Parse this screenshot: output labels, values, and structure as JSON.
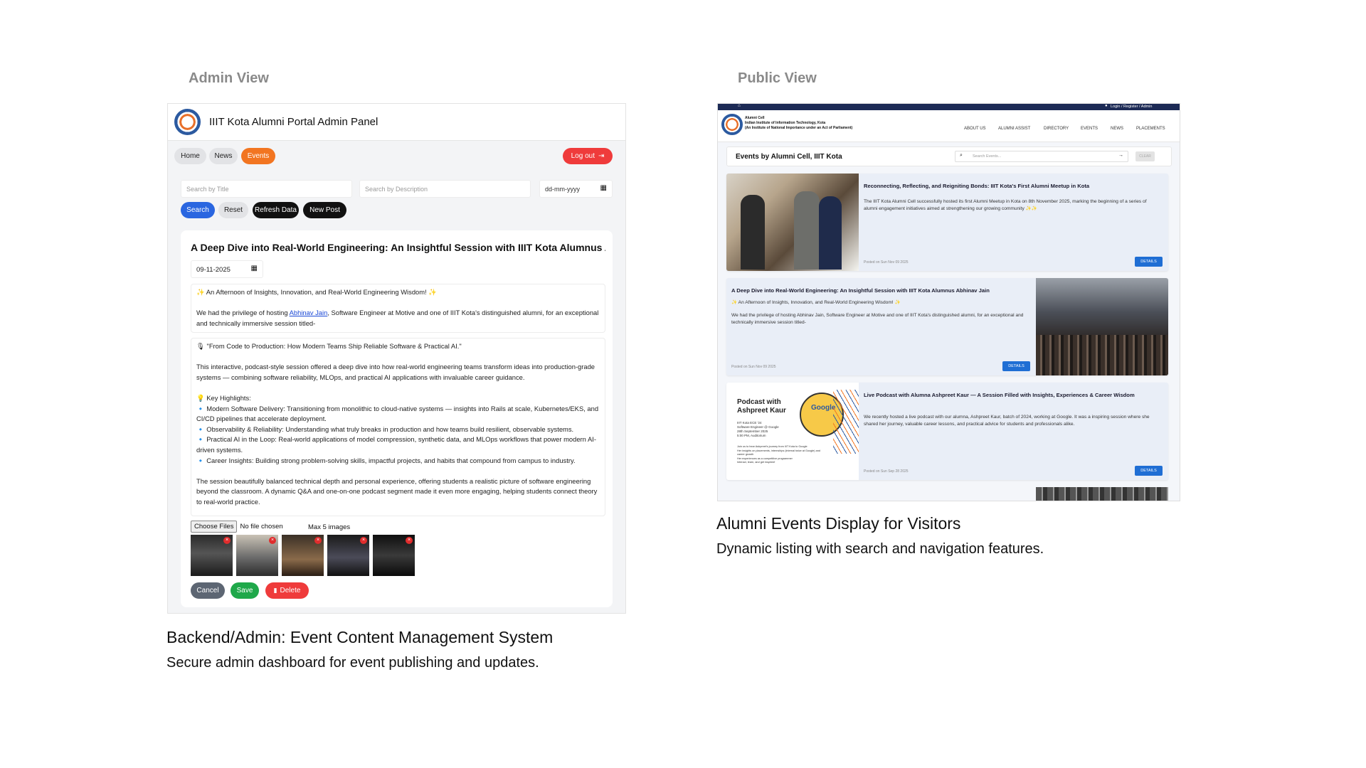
{
  "sections": {
    "admin_heading": "Admin View",
    "public_heading": "Public View"
  },
  "admin": {
    "title": "IIIT Kota Alumni Portal Admin Panel",
    "nav": {
      "home": "Home",
      "news": "News",
      "events": "Events"
    },
    "logout_label": "Log out",
    "filters": {
      "title_placeholder": "Search by Title",
      "description_placeholder": "Search by Description",
      "date_placeholder": "dd-mm-yyyy"
    },
    "actions": {
      "search": "Search",
      "reset": "Reset",
      "refresh": "Refresh Data",
      "new_post": "New Post"
    },
    "post": {
      "title": "A Deep Dive into Real-World Engineering: An Insightful Session with IIIT Kota Alumnus Abhinav Jain",
      "date": "09-11-2025",
      "intro_headline": "✨ An Afternoon of Insights, Innovation, and Real-World Engineering Wisdom! ✨",
      "intro_pre": "We had the privilege of hosting ",
      "intro_link": "Abhinav Jain",
      "intro_post": ", Software Engineer at Motive and one of IIIT Kota's distinguished alumni, for an exceptional and technically immersive session titled-",
      "session_title": "🎙 \"From Code to Production: How Modern Teams Ship Reliable Software & Practical AI.\"",
      "session_desc": "This interactive, podcast-style session offered a deep dive into how real-world engineering teams transform ideas into production-grade systems — combining software reliability, MLOps, and practical AI applications with invaluable career guidance.",
      "highlights_heading": "💡 Key Highlights:",
      "highlights": [
        "🔹 Modern Software Delivery: Transitioning from monolithic to cloud-native systems — insights into Rails at scale, Kubernetes/EKS, and CI/CD pipelines that accelerate deployment.",
        "🔹 Observability & Reliability: Understanding what truly breaks in production and how teams build resilient, observable systems.",
        "🔹 Practical AI in the Loop: Real-world applications of model compression, synthetic data, and MLOps workflows that power modern AI-driven systems.",
        "🔹 Career Insights: Building strong problem-solving skills, impactful projects, and habits that compound from campus to industry."
      ],
      "closing": "The session beautifully balanced technical depth and personal experience, offering students a realistic picture of software engineering beyond the classroom. A dynamic Q&A and one-on-one podcast segment made it even more engaging, helping students connect theory to real-world practice.",
      "choose_files": "Choose Files",
      "no_file": "No file chosen",
      "max_images": "Max 5 images",
      "cancel": "Cancel",
      "save": "Save",
      "delete": "Delete"
    }
  },
  "public": {
    "topbar_links": "Login / Register / Admin",
    "org": {
      "line1": "Alumni Cell",
      "line2": "Indian Institute of Information Technology, Kota",
      "line3": "(An Institute of National Importance under an Act of Parliament)"
    },
    "nav": [
      "ABOUT US",
      "ALUMNI ASSIST",
      "DIRECTORY",
      "EVENTS",
      "NEWS",
      "PLACEMENTS"
    ],
    "events_heading": "Events by Alumni Cell, IIIT Kota",
    "search_placeholder": "Search Events...",
    "clear_label": "CLEAR",
    "details_label": "DETAILS",
    "events": [
      {
        "title": "Reconnecting, Reflecting, and Reigniting Bonds: IIIT Kota's First Alumni Meetup in Kota",
        "body": "The IIIT Kota Alumni Cell successfully hosted its first Alumni Meetup in Kota on 8th November 2025, marking the beginning of a series of alumni engagement initiatives aimed at strengthening our growing community ✨✨",
        "date": "Posted on Sun Nov 09 2025"
      },
      {
        "title": "A Deep Dive into Real-World Engineering: An Insightful Session with IIIT Kota Alumnus Abhinav Jain",
        "body_headline": "✨ An Afternoon of Insights, Innovation, and Real-World Engineering Wisdom! ✨",
        "body": "We had the privilege of hosting Abhinav Jain, Software Engineer at Motive and one of IIIT Kota's distinguished alumni, for an exceptional and technically immersive session titled-",
        "date": "Posted on Sun Nov 09 2025"
      },
      {
        "title": "Live Podcast with Alumna Ashpreet Kaur — A Session Filled with Insights, Experiences & Career Wisdom",
        "body": "We recently hosted a live podcast with our alumna, Ashpreet Kaur, batch of 2024, working at Google. It was a inspiring session where she shared her journey, valuable career lessons, and practical advice for students and professionals alike.",
        "date": "Posted on Sun Sep 28 2025",
        "poster": {
          "title": "Podcast with Ashpreet Kaur",
          "sub1": "IIIT Kota ECE '24",
          "sub2": "Software Engineer @ Google",
          "sub3": "28th September 2025",
          "sub4": "5:00 PM, Auditorium",
          "badge": "Google",
          "b1": "Join us to hear Ashpreet's journey from IIIT Kota to Google",
          "b2": "Her insights on placements, internships (internal twice at Google) and career growth",
          "b3": "Her experiences as a competitive programmer",
          "b4": "Interact, learn, and get inspired!"
        }
      }
    ]
  },
  "captions": {
    "admin_heading": "Backend/Admin: Event Content Management System",
    "admin_sub": "Secure admin dashboard for event publishing and updates.",
    "public_heading": "Alumni Events Display for Visitors",
    "public_sub": "Dynamic listing with search and navigation features."
  }
}
